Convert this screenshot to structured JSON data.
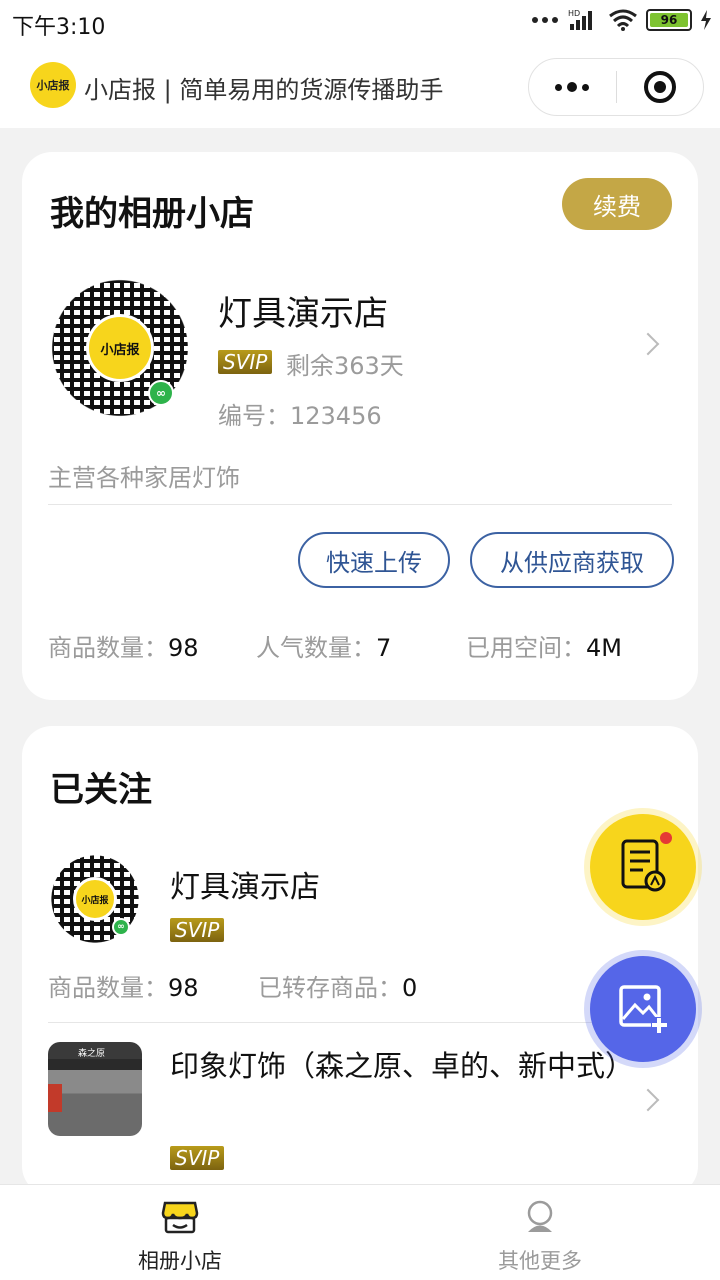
{
  "status_bar": {
    "time": "下午3:10",
    "network": "HD",
    "battery": "96"
  },
  "nav": {
    "logo_text": "小店报",
    "title": "小店报 | 简单易用的货源传播助手"
  },
  "my_shop_card": {
    "title": "我的相册小店",
    "renew_label": "续费",
    "qr_center_text": "小店报",
    "shop_name": "灯具演示店",
    "svip_badge": "SVIP",
    "remaining": "剩余363天",
    "id_label": "编号：",
    "id_value": "123456",
    "description": "主营各种家居灯饰",
    "quick_upload_label": "快速上传",
    "from_supplier_label": "从供应商获取",
    "stats": [
      {
        "label": "商品数量：",
        "value": "98"
      },
      {
        "label": "人气数量：",
        "value": "7"
      },
      {
        "label": "已用空间：",
        "value": "4M"
      }
    ]
  },
  "followed_card": {
    "title": "已关注",
    "items": [
      {
        "qr_center_text": "小店报",
        "name": "灯具演示店",
        "badge": "SVIP",
        "stats": [
          {
            "label": "商品数量：",
            "value": "98"
          },
          {
            "label": "已转存商品：",
            "value": "0"
          }
        ]
      },
      {
        "thumb_sign": "森之原",
        "name": "印象灯饰（森之原、卓的、新中式）",
        "badge": "SVIP"
      }
    ]
  },
  "tabbar": {
    "tabs": [
      {
        "label": "相册小店",
        "active": true,
        "icon": "shop-icon"
      },
      {
        "label": "其他更多",
        "active": false,
        "icon": "profile-icon"
      }
    ]
  },
  "colors": {
    "brand_yellow": "#f7d51c",
    "renew_gold": "#c4a746",
    "outline_blue": "#3c62a3",
    "fab_blue": "#5566e8"
  }
}
